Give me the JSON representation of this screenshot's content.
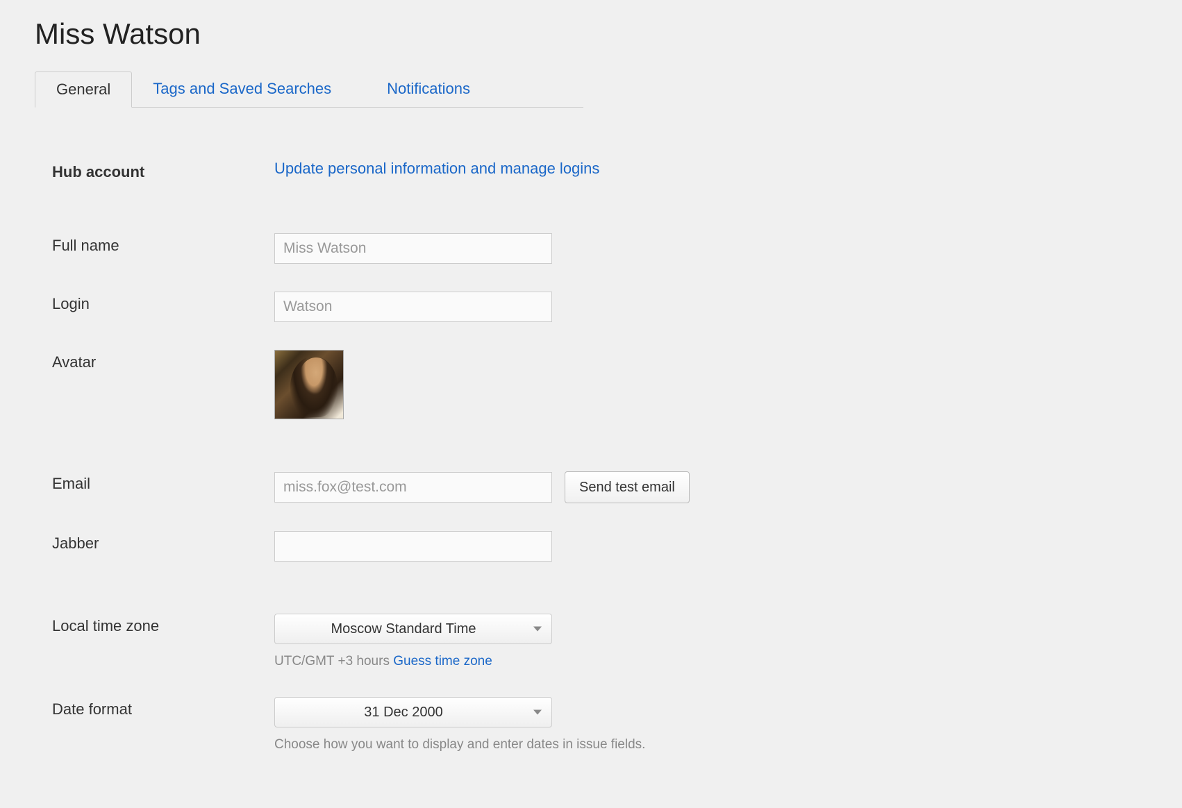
{
  "page": {
    "title": "Miss Watson"
  },
  "tabs": {
    "general": "General",
    "tags": "Tags and Saved Searches",
    "notifications": "Notifications"
  },
  "labels": {
    "hub_account": "Hub account",
    "full_name": "Full name",
    "login": "Login",
    "avatar": "Avatar",
    "email": "Email",
    "jabber": "Jabber",
    "local_time_zone": "Local time zone",
    "date_format": "Date format"
  },
  "values": {
    "hub_link": "Update personal information and manage logins",
    "full_name": "Miss Watson",
    "login": "Watson",
    "email": "miss.fox@test.com",
    "jabber": "",
    "time_zone": "Moscow Standard Time",
    "time_zone_hint_prefix": "UTC/GMT +3 hours ",
    "time_zone_guess": "Guess time zone",
    "date_format": "31 Dec 2000",
    "date_format_hint": "Choose how you want to display and enter dates in issue fields."
  },
  "buttons": {
    "send_test_email": "Send test email"
  }
}
